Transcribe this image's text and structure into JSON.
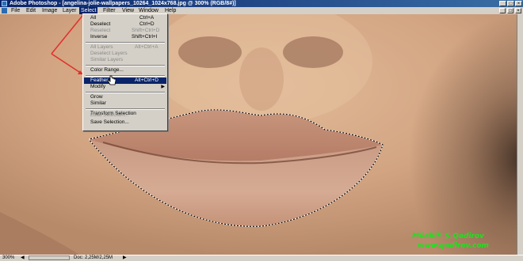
{
  "window": {
    "title": "Adobe Photoshop - [angelina-jolie-wallpapers_10264_1024x768.jpg @ 300% (RGB/8#)]",
    "controls": [
      "_",
      "□",
      "×"
    ]
  },
  "menubar": {
    "items": [
      "File",
      "Edit",
      "Image",
      "Layer",
      "Select",
      "Filter",
      "View",
      "Window",
      "Help"
    ],
    "active": "Select",
    "doc_controls": [
      "_",
      "□",
      "×"
    ]
  },
  "select_menu": {
    "items": [
      {
        "label": "All",
        "shortcut": "Ctrl+A",
        "enabled": true
      },
      {
        "label": "Deselect",
        "shortcut": "Ctrl+D",
        "enabled": true
      },
      {
        "label": "Reselect",
        "shortcut": "Shift+Ctrl+D",
        "enabled": false
      },
      {
        "label": "Inverse",
        "shortcut": "Shift+Ctrl+I",
        "enabled": true
      },
      {
        "label": "All Layers",
        "shortcut": "Alt+Ctrl+A",
        "enabled": false
      },
      {
        "label": "Deselect Layers",
        "shortcut": "",
        "enabled": false
      },
      {
        "label": "Similar Layers",
        "shortcut": "",
        "enabled": false
      },
      {
        "label": "Color Range...",
        "shortcut": "",
        "enabled": true
      },
      {
        "label": "Feather...",
        "shortcut": "Alt+Ctrl+D",
        "enabled": true,
        "highlighted": true
      },
      {
        "label": "Modify",
        "shortcut": "",
        "enabled": true,
        "submenu": true
      },
      {
        "label": "Grow",
        "shortcut": "",
        "enabled": true
      },
      {
        "label": "Similar",
        "shortcut": "",
        "enabled": true
      },
      {
        "label": "Transform Selection",
        "shortcut": "",
        "enabled": true
      },
      {
        "label": "Load Selection...",
        "shortcut": "",
        "enabled": false
      },
      {
        "label": "Save Selection...",
        "shortcut": "",
        "enabled": true
      }
    ]
  },
  "status": {
    "zoom": "300%",
    "doc": "Doc: 2,25M/2,25M"
  },
  "credit": {
    "line1": "Müellif: Ş.Qədirov",
    "line2": "www.qadirov.com"
  },
  "colors": {
    "title_bar": "#0a246a",
    "menu_highlight": "#0a246a",
    "annotation_arrow": "#e0302a",
    "credit_text": "#1fe11f"
  }
}
